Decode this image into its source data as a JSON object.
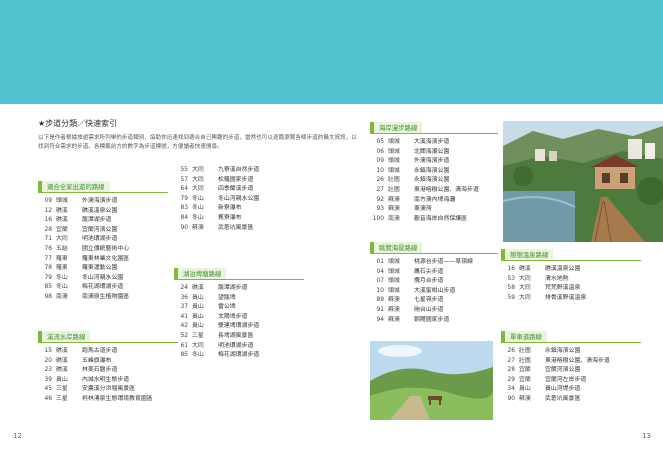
{
  "pages": {
    "left": "12",
    "right": "13"
  },
  "intro": {
    "title": "★步道分類／快速索引",
    "body": "以下是作者根據旅遊需求所列舉的步道類別，協助你迅速找到適合自己興趣的步道，當然也可以逐篇瀏覽各條步道的攝文資訊，以找到符合需求的步道。各標籤前方的數字為步道標號，方便讀者快速搜尋。"
  },
  "sections": {
    "family": {
      "title": "適合全家出遊的路線",
      "entries": [
        {
          "num": "09",
          "city": "頭城",
          "name": "外澳海濱步道"
        },
        {
          "num": "12",
          "city": "礁溪",
          "name": "礁溪溫泉公園"
        },
        {
          "num": "16",
          "city": "礁溪",
          "name": "龍潭湖步道"
        },
        {
          "num": "28",
          "city": "宜蘭",
          "name": "宜蘭河濱公園"
        },
        {
          "num": "71",
          "city": "大同",
          "name": "明池環湖步道"
        },
        {
          "num": "76",
          "city": "五結",
          "name": "國立傳統藝術中心"
        },
        {
          "num": "77",
          "city": "羅東",
          "name": "羅東林業文化園區"
        },
        {
          "num": "78",
          "city": "羅東",
          "name": "羅東運動公園"
        },
        {
          "num": "79",
          "city": "冬山",
          "name": "冬山河親水公園"
        },
        {
          "num": "85",
          "city": "冬山",
          "name": "梅花湖環湖步道"
        },
        {
          "num": "98",
          "city": "南澳",
          "name": "南澳原生植物園區"
        }
      ]
    },
    "family2": {
      "entries": [
        {
          "num": "55",
          "city": "大同",
          "name": "九寮溪自然步道"
        },
        {
          "num": "57",
          "city": "大同",
          "name": "松羅國家步道"
        },
        {
          "num": "64",
          "city": "大同",
          "name": "四季蘭溪步道"
        },
        {
          "num": "79",
          "city": "冬山",
          "name": "冬山河親水公園"
        },
        {
          "num": "83",
          "city": "冬山",
          "name": "新寮瀑布"
        },
        {
          "num": "84",
          "city": "冬山",
          "name": "舊寮瀑布"
        },
        {
          "num": "90",
          "city": "蘇澳",
          "name": "武荖坑風景區"
        }
      ]
    },
    "stream": {
      "title": "溪流水岸路線",
      "entries": [
        {
          "num": "15",
          "city": "礁溪",
          "name": "跑馬古道步道"
        },
        {
          "num": "20",
          "city": "礁溪",
          "name": "五峰旗瀑布"
        },
        {
          "num": "23",
          "city": "礁溪",
          "name": "林美石磐步道"
        },
        {
          "num": "39",
          "city": "員山",
          "name": "內城水明生態步道"
        },
        {
          "num": "45",
          "city": "三星",
          "name": "安農溪分洪堰風景區"
        },
        {
          "num": "46",
          "city": "三星",
          "name": "柯林湧泉生態環境教育園區"
        }
      ]
    },
    "lake": {
      "title": "湖泊埤塘路線",
      "entries": [
        {
          "num": "24",
          "city": "礁溪",
          "name": "龍潭湖步道"
        },
        {
          "num": "36",
          "city": "員山",
          "name": "望龍埤"
        },
        {
          "num": "37",
          "city": "員山",
          "name": "雷公埤"
        },
        {
          "num": "41",
          "city": "員山",
          "name": "太陽埤步道"
        },
        {
          "num": "42",
          "city": "員山",
          "name": "雙連埤環湖步道"
        },
        {
          "num": "52",
          "city": "三星",
          "name": "長埤湖風景區"
        },
        {
          "num": "61",
          "city": "大同",
          "name": "明池環湖步道"
        },
        {
          "num": "85",
          "city": "冬山",
          "name": "梅花湖環湖步道"
        }
      ]
    },
    "coast": {
      "title": "海岸漫步路線",
      "entries": [
        {
          "num": "05",
          "city": "頭城",
          "name": "大溪海濱步道"
        },
        {
          "num": "06",
          "city": "頭城",
          "name": "北關海潮公園"
        },
        {
          "num": "09",
          "city": "頭城",
          "name": "外澳海濱步道"
        },
        {
          "num": "10",
          "city": "頭城",
          "name": "永鎮海濱公園"
        },
        {
          "num": "26",
          "city": "壯圍",
          "name": "永鎮海濱公園"
        },
        {
          "num": "27",
          "city": "壯圍",
          "name": "東港榕樹公園、清海步道"
        },
        {
          "num": "92",
          "city": "蘇澳",
          "name": "南方澳內埤海灘"
        },
        {
          "num": "93",
          "city": "蘇澳",
          "name": "東澳灣"
        },
        {
          "num": "100",
          "city": "南澳",
          "name": "觀音海岸自然保護區"
        }
      ]
    },
    "view": {
      "title": "眺覽海景路線",
      "entries": [
        {
          "num": "01",
          "city": "頭城",
          "name": "桃源谷步道——草嶺線"
        },
        {
          "num": "04",
          "city": "頭城",
          "name": "鷹石尖步道"
        },
        {
          "num": "07",
          "city": "頭城",
          "name": "攬月台步道"
        },
        {
          "num": "10",
          "city": "頭城",
          "name": "大溪蜜柑山步道"
        },
        {
          "num": "89",
          "city": "蘇澳",
          "name": "七星嶺步道"
        },
        {
          "num": "91",
          "city": "蘇澳",
          "name": "砲台山步道"
        },
        {
          "num": "94",
          "city": "蘇澳",
          "name": "朝陽國家步道"
        }
      ]
    },
    "hotspring": {
      "title": "戀戀溫泉路線",
      "entries": [
        {
          "num": "16",
          "city": "礁溪",
          "name": "礁溪溫泉公園"
        },
        {
          "num": "53",
          "city": "大同",
          "name": "清水地熱"
        },
        {
          "num": "58",
          "city": "大同",
          "name": "梵梵野溪溫泉"
        },
        {
          "num": "59",
          "city": "大同",
          "name": "排骨溪野溪溫泉"
        }
      ]
    },
    "bike": {
      "title": "單車道路線",
      "entries": [
        {
          "num": "26",
          "city": "壯圍",
          "name": "永鎮海濱公園"
        },
        {
          "num": "27",
          "city": "壯圍",
          "name": "東港榕樹公園、清海步道"
        },
        {
          "num": "28",
          "city": "宜蘭",
          "name": "宜蘭河濱公園"
        },
        {
          "num": "29",
          "city": "宜蘭",
          "name": "宜蘭河左岸步道"
        },
        {
          "num": "34",
          "city": "員山",
          "name": "員山河堤步道"
        },
        {
          "num": "90",
          "city": "蘇澳",
          "name": "武荖坑風景區"
        }
      ]
    }
  }
}
